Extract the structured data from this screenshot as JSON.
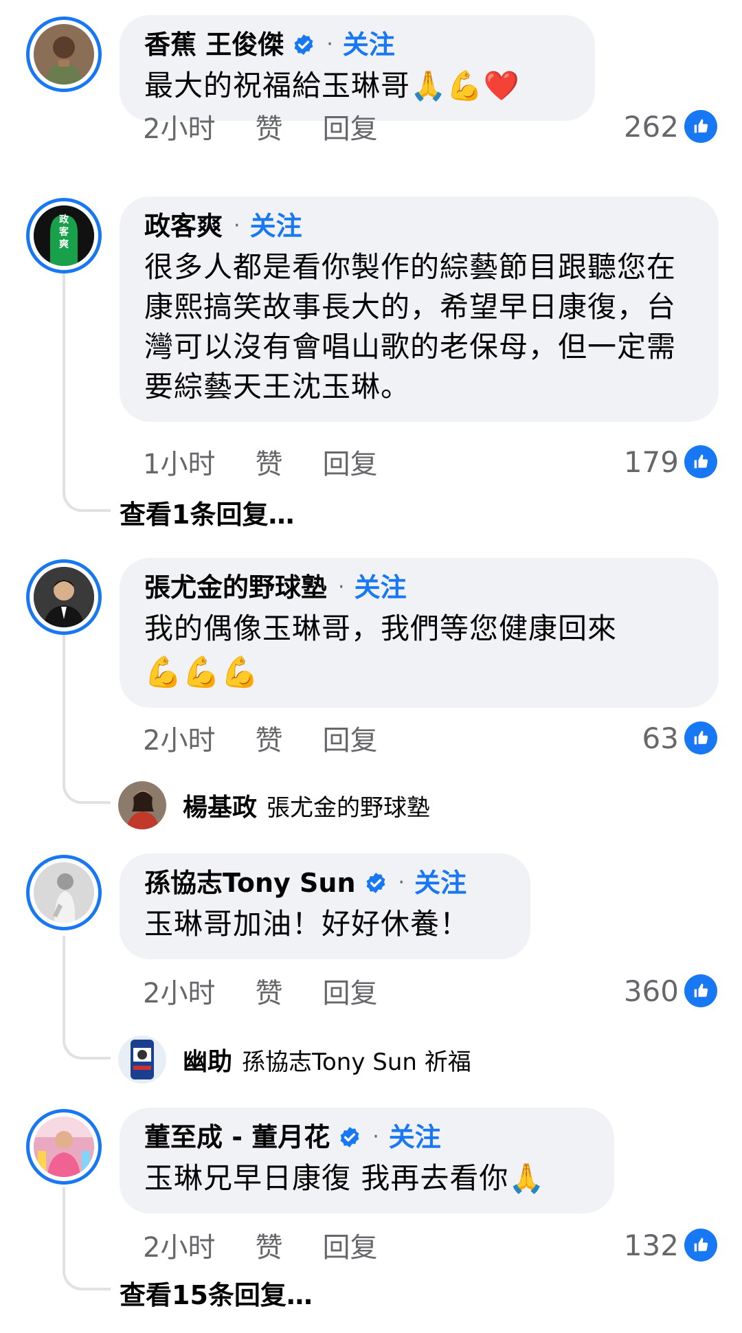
{
  "comments": [
    {
      "name": "香蕉 王俊傑",
      "verified": true,
      "follow": "关注",
      "text": "最大的祝福給玉琳哥🙏💪❤️",
      "time": "2小时",
      "like": "赞",
      "reply": "回复",
      "likes": "262"
    },
    {
      "name": "政客爽",
      "verified": false,
      "follow": "关注",
      "text": "很多人都是看你製作的綜藝節目跟聽您在康熙搞笑故事長大的，希望早日康復，台灣可以沒有會唱山歌的老保母，但一定需要綜藝天王沈玉琳。",
      "avatar_text": "政客爽",
      "time": "1小时",
      "like": "赞",
      "reply": "回复",
      "likes": "179",
      "view_replies": "查看1条回复…"
    },
    {
      "name": "張尤金的野球塾",
      "verified": false,
      "follow": "关注",
      "text": "我的偶像玉琳哥，我們等您健康回來",
      "emoji_line": "💪💪💪",
      "time": "2小时",
      "like": "赞",
      "reply": "回复",
      "likes": "63",
      "reply_preview": {
        "name": "楊基政",
        "text": "張尤金的野球塾"
      }
    },
    {
      "name": "孫協志Tony Sun",
      "verified": true,
      "follow": "关注",
      "text": "玉琳哥加油！好好休養！",
      "time": "2小时",
      "like": "赞",
      "reply": "回复",
      "likes": "360",
      "reply_preview": {
        "name": "幽助",
        "text": "孫協志Tony Sun 祈福"
      }
    },
    {
      "name": "董至成 - 董月花",
      "verified": true,
      "follow": "关注",
      "text": "玉琳兄早日康復 我再去看你🙏",
      "time": "2小时",
      "like": "赞",
      "reply": "回复",
      "likes": "132",
      "view_replies": "查看15条回复…"
    }
  ],
  "colors": {
    "accent": "#1877f2",
    "bubble": "#f0f2f5",
    "meta": "#65676b"
  },
  "icons": [
    "verified-badge-icon",
    "thumbs-up-icon",
    "avatar-photo"
  ]
}
